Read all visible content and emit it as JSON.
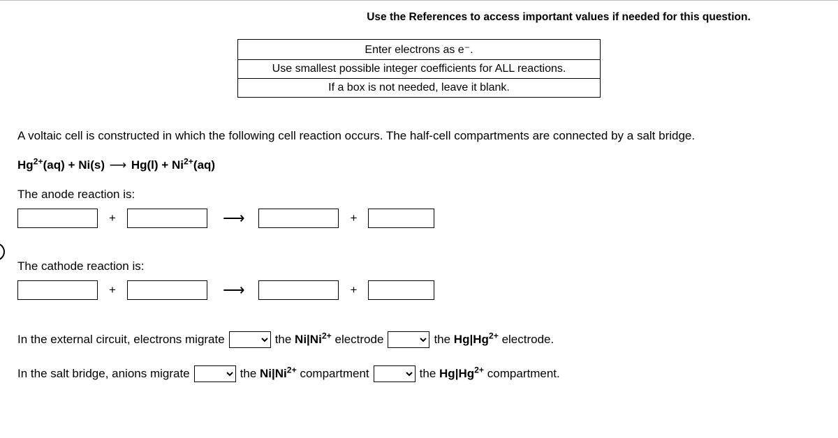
{
  "top_instruction": "Use the References to access important values if needed for this question.",
  "hints": {
    "row1": "Enter electrons as e⁻.",
    "row2": "Use smallest possible integer coefficients for ALL reactions.",
    "row3": "If a box is not needed, leave it blank."
  },
  "intro": "A voltaic cell is constructed in which the following cell reaction occurs. The half-cell compartments are connected by a salt bridge.",
  "reaction": {
    "lhs1": "Hg",
    "lhs1_sup": "2+",
    "lhs1_state": "(aq)",
    "plus": "+",
    "lhs2": "Ni(s)",
    "arrow": "⟶",
    "rhs1": "Hg(l)",
    "rhs2": "Ni",
    "rhs2_sup": "2+",
    "rhs2_state": "(aq)"
  },
  "anode_label": "The anode reaction is:",
  "cathode_label": "The cathode reaction is:",
  "plus_sign": "+",
  "arrow_sign": "⟶",
  "external": {
    "prefix": "In the external circuit, electrons migrate",
    "mid1_a": "the ",
    "mid1_b": "Ni|Ni",
    "mid1_sup": "2+",
    "mid1_c": " electrode",
    "mid2_a": "the ",
    "mid2_b": "Hg|Hg",
    "mid2_sup": "2+",
    "mid2_c": " electrode."
  },
  "salt": {
    "prefix": "In the salt bridge, anions migrate",
    "mid1_a": "the ",
    "mid1_b": "Ni|Ni",
    "mid1_sup": "2+",
    "mid1_c": " compartment",
    "mid2_a": "the ",
    "mid2_b": "Hg|Hg",
    "mid2_sup": "2+",
    "mid2_c": " compartment."
  }
}
